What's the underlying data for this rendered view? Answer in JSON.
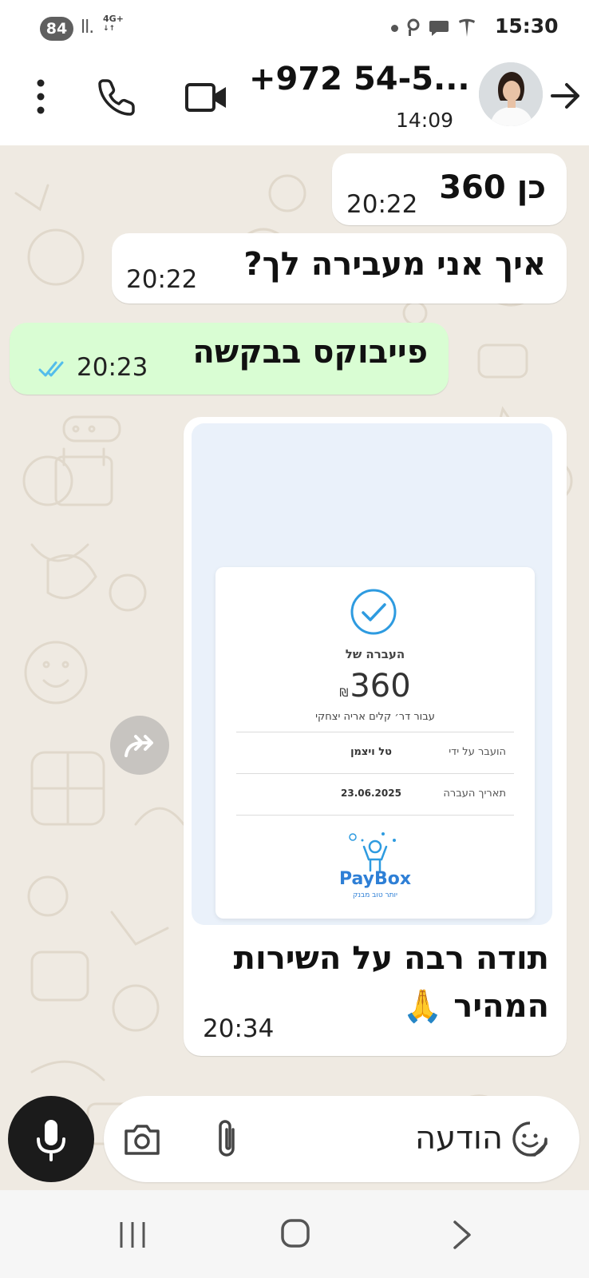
{
  "status_bar": {
    "battery": "84",
    "network": "4G+",
    "time": "15:30"
  },
  "header": {
    "contact_name": "+972 54-5...",
    "last_seen": "14:09"
  },
  "messages": [
    {
      "direction": "incoming",
      "text": "כן 360",
      "time": "20:22"
    },
    {
      "direction": "incoming",
      "text": "איך אני מעבירה לך?",
      "time": "20:22"
    },
    {
      "direction": "outgoing",
      "text": "פייבוקס בבקשה",
      "time": "20:23",
      "status": "read"
    }
  ],
  "receipt": {
    "title": "העברה של",
    "amount": "360",
    "currency": "₪",
    "for_line": "עבור דר׳ קלים אריה יצחקי",
    "sent_by_label": "הועבר על ידי",
    "sent_by_value": "טל ויצמן",
    "date_label": "תאריך העברה",
    "date_value": "23.06.2025",
    "brand": "PayBox",
    "tagline": "יותר טוב מבנק"
  },
  "image_message": {
    "caption_line1": "תודה רבה על השירות",
    "caption_line2": "המהיר",
    "emoji": "🙏",
    "time": "20:34"
  },
  "composer": {
    "placeholder": "הודעה"
  },
  "colors": {
    "chat_bg": "#efeae2",
    "outgoing_bubble": "#d9fdd3",
    "incoming_bubble": "#ffffff",
    "read_ticks": "#53bdeb",
    "paybox_blue": "#2e7fd6"
  }
}
